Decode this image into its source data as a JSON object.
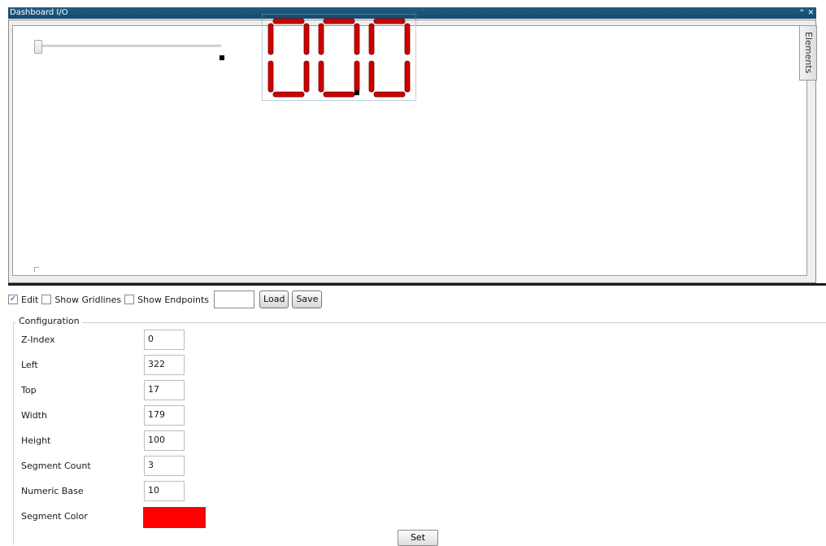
{
  "window": {
    "title": "Dashboard I/O",
    "collapse_glyph": "⌃",
    "close_glyph": "✕",
    "collapse_icon": "chevron-up-icon",
    "close_icon": "close-icon"
  },
  "canvas": {
    "elements_tab_label": "Elements",
    "slider": {
      "value_fraction": 0.0
    },
    "segment_display": {
      "digits": [
        "0",
        "0",
        "0"
      ],
      "segment_color": "#cc0000"
    }
  },
  "toolbar": {
    "edit_label": "Edit",
    "edit_checked": true,
    "gridlines_label": "Show Gridlines",
    "gridlines_checked": false,
    "endpoints_label": "Show Endpoints",
    "endpoints_checked": false,
    "text_value": "",
    "load_label": "Load",
    "save_label": "Save"
  },
  "config": {
    "legend": "Configuration",
    "rows": [
      {
        "label": "Z-Index",
        "value": "0"
      },
      {
        "label": "Left",
        "value": "322"
      },
      {
        "label": "Top",
        "value": "17"
      },
      {
        "label": "Width",
        "value": "179"
      },
      {
        "label": "Height",
        "value": "100"
      },
      {
        "label": "Segment Count",
        "value": "3"
      },
      {
        "label": "Numeric Base",
        "value": "10"
      }
    ],
    "color_label": "Segment Color",
    "color_value": "#ff0000",
    "set_label": "Set"
  },
  "colors": {
    "titlebar": "#1a5277",
    "segment_on": "#cc0000"
  }
}
